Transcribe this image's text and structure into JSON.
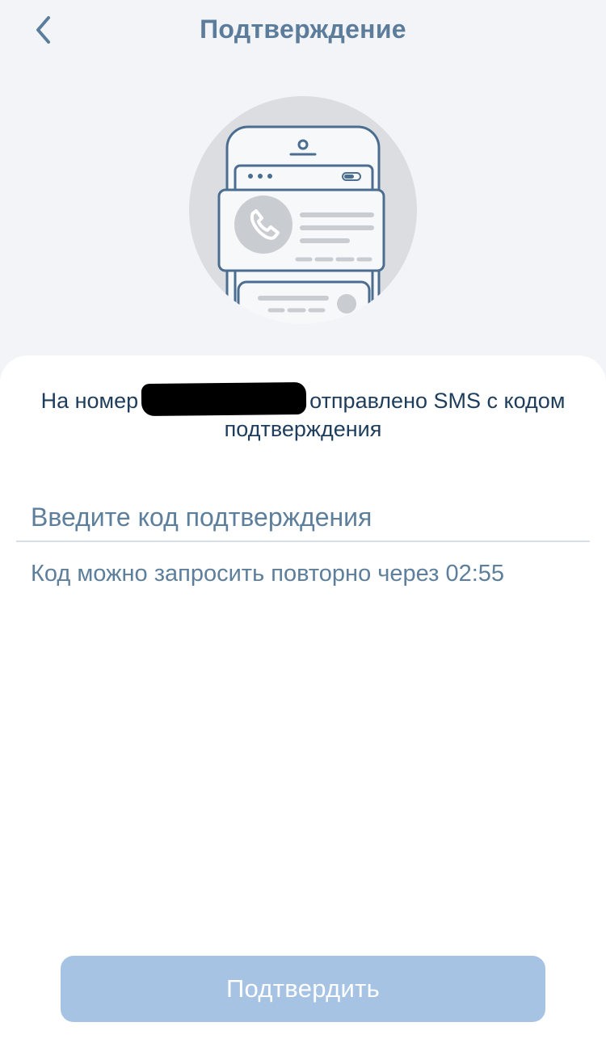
{
  "header": {
    "title": "Подтверждение",
    "back_icon": "chevron-left-icon"
  },
  "illustration": {
    "icon": "phone-call-notification-illustration"
  },
  "message": {
    "prefix": "На номер",
    "suffix": "отправлено SMS с кодом подтверждения"
  },
  "code_input": {
    "placeholder": "Введите код подтверждения",
    "value": ""
  },
  "resend": {
    "text": "Код можно запросить повторно через",
    "timer": "02:55"
  },
  "confirm_button": {
    "label": "Подтвердить"
  },
  "colors": {
    "background": "#f3f4f7",
    "title": "#5b7d9b",
    "message_text": "#1e3d5c",
    "secondary_text": "#5e7f9c",
    "button_disabled": "#a7c3e4"
  }
}
